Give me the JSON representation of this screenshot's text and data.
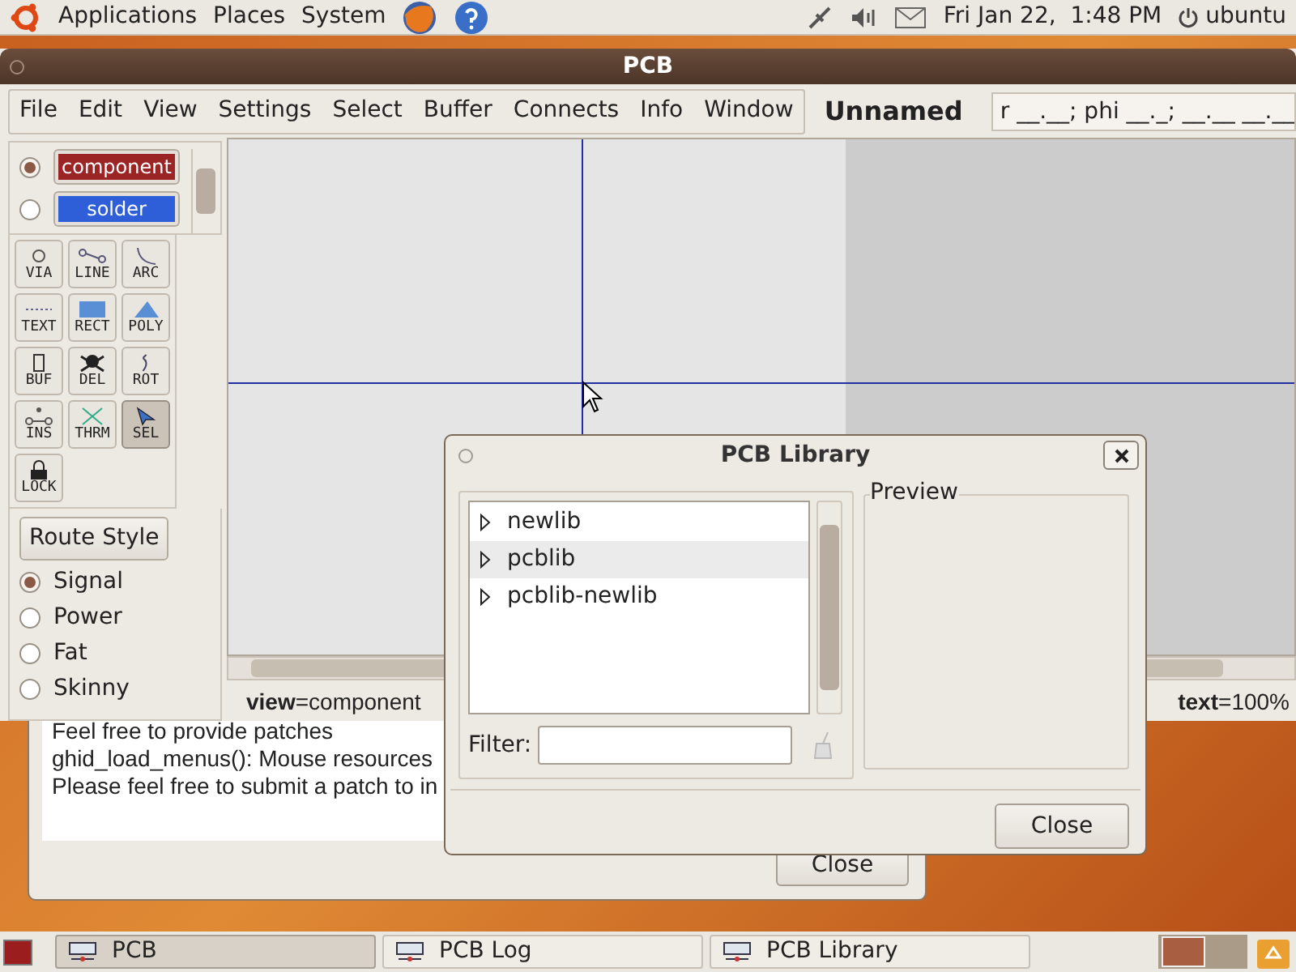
{
  "top_panel": {
    "menus": [
      "Applications",
      "Places",
      "System"
    ],
    "clock": "Fri Jan 22,  1:48 PM",
    "user": "ubuntu"
  },
  "pcb_window": {
    "title": "PCB",
    "menu": [
      "File",
      "Edit",
      "View",
      "Settings",
      "Select",
      "Buffer",
      "Connects",
      "Info",
      "Window"
    ],
    "file_name": "Unnamed",
    "cursor_position": "r __.__; phi __._; __.__ __.__",
    "layers": [
      {
        "label": "component",
        "color": "#9b2424",
        "selected": true
      },
      {
        "label": "solder",
        "color": "#2f5fd8",
        "selected": false
      }
    ],
    "tools": [
      {
        "kind": "via",
        "label": "VIA",
        "selected": false
      },
      {
        "kind": "line",
        "label": "LINE",
        "selected": false
      },
      {
        "kind": "arc",
        "label": "ARC",
        "selected": false
      },
      {
        "kind": "text",
        "label": "TEXT",
        "selected": false
      },
      {
        "kind": "rect",
        "label": "RECT",
        "selected": false
      },
      {
        "kind": "poly",
        "label": "POLY",
        "selected": false
      },
      {
        "kind": "buf",
        "label": "BUF",
        "selected": false
      },
      {
        "kind": "del",
        "label": "DEL",
        "selected": false
      },
      {
        "kind": "rot",
        "label": "ROT",
        "selected": false
      },
      {
        "kind": "ins",
        "label": "INS",
        "selected": false
      },
      {
        "kind": "thrm",
        "label": "THRM",
        "selected": false
      },
      {
        "kind": "sel",
        "label": "SEL",
        "selected": true
      },
      {
        "kind": "lock",
        "label": "LOCK",
        "selected": false
      }
    ],
    "route_style_button": "Route Style",
    "route_styles": [
      {
        "label": "Signal",
        "selected": true
      },
      {
        "label": "Power",
        "selected": false
      },
      {
        "label": "Fat",
        "selected": false
      },
      {
        "label": "Skinny",
        "selected": false
      }
    ],
    "status": [
      "**view**=component",
      "**text**=100%"
    ]
  },
  "log_window": {
    "lines": [
      "Feel free to provide patches",
      "ghid_load_menus():  Mouse resources",
      "Please feel free to submit a patch to in"
    ],
    "close_button": "Close"
  },
  "library_dialog": {
    "title": "PCB Library",
    "items": [
      {
        "label": "newlib",
        "selected": false,
        "expanded": false
      },
      {
        "label": "pcblib",
        "selected": true,
        "expanded": false
      },
      {
        "label": "pcblib-newlib",
        "selected": false,
        "expanded": false
      }
    ],
    "filter_label": "Filter:",
    "preview_label": "Preview",
    "close_button": "Close"
  },
  "taskbar": [
    {
      "label": "PCB",
      "selected": true
    },
    {
      "label": "PCB Log",
      "selected": false
    },
    {
      "label": "PCB Library",
      "selected": false
    }
  ]
}
